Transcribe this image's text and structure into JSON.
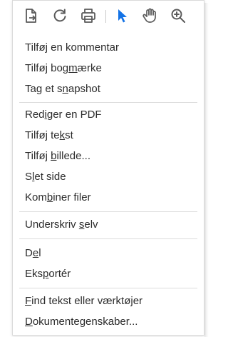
{
  "toolbar": {
    "buttons": [
      {
        "icon": "page-export-icon"
      },
      {
        "icon": "rotate-refresh-icon"
      },
      {
        "icon": "printer-icon"
      },
      {
        "icon": "select-cursor-icon",
        "active": true,
        "color": "#1473e6"
      },
      {
        "icon": "hand-pan-icon"
      },
      {
        "icon": "zoom-in-icon"
      }
    ]
  },
  "menu": {
    "groups": [
      [
        {
          "name": "add-comment",
          "pre": "Tilføj en kommentar",
          "mn": "",
          "post": ""
        },
        {
          "name": "add-bookmark",
          "pre": "Tilføj bog",
          "mn": "m",
          "post": "ærke"
        },
        {
          "name": "take-snapshot",
          "pre": "Tag et s",
          "mn": "n",
          "post": "apshot"
        }
      ],
      [
        {
          "name": "edit-pdf",
          "pre": "Red",
          "mn": "i",
          "post": "ger en PDF"
        },
        {
          "name": "add-text",
          "pre": "Tilføj te",
          "mn": "k",
          "post": "st"
        },
        {
          "name": "add-image",
          "pre": "Tilføj ",
          "mn": "b",
          "post": "illede..."
        },
        {
          "name": "delete-page",
          "pre": "S",
          "mn": "l",
          "post": "et side"
        },
        {
          "name": "combine-files",
          "pre": "Kom",
          "mn": "b",
          "post": "iner filer"
        }
      ],
      [
        {
          "name": "sign-yourself",
          "pre": "Underskriv ",
          "mn": "s",
          "post": "elv"
        }
      ],
      [
        {
          "name": "share",
          "pre": "D",
          "mn": "e",
          "post": "l"
        },
        {
          "name": "export",
          "pre": "Eks",
          "mn": "p",
          "post": "ortér"
        }
      ],
      [
        {
          "name": "find-text-or-tools",
          "pre": "",
          "mn": "F",
          "post": "ind tekst eller værktøjer"
        },
        {
          "name": "document-properties",
          "pre": "",
          "mn": "D",
          "post": "okumentegenskaber..."
        }
      ]
    ]
  },
  "colors": {
    "text": "#2c2c2c",
    "icon": "#5a5a5a",
    "accent": "#1473e6",
    "separator": "#dcdcdc"
  }
}
